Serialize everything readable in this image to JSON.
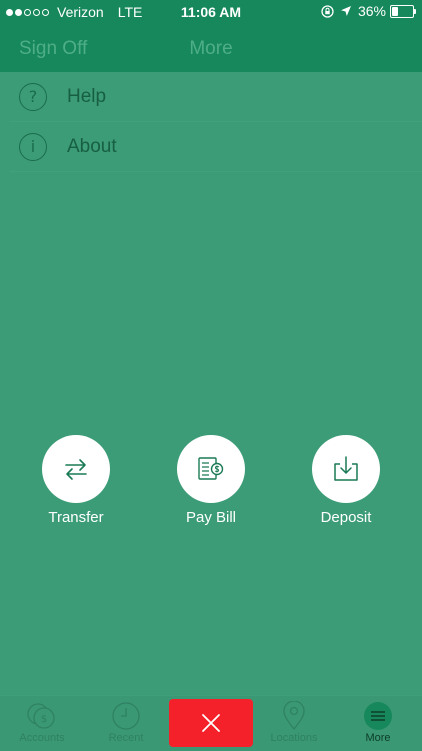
{
  "status_bar": {
    "carrier": "Verizon",
    "network": "LTE",
    "time": "11:06 AM",
    "battery_percent": "36%",
    "battery_level": 0.36,
    "signal_bars": 2,
    "signal_total": 5
  },
  "nav": {
    "left_label": "Sign Off",
    "title": "More"
  },
  "menu": {
    "items": [
      {
        "icon": "help-icon",
        "glyph": "?",
        "label": "Help"
      },
      {
        "icon": "info-icon",
        "glyph": "i",
        "label": "About"
      }
    ]
  },
  "actions": [
    {
      "icon": "transfer-icon",
      "label": "Transfer"
    },
    {
      "icon": "pay-bill-icon",
      "label": "Pay Bill"
    },
    {
      "icon": "deposit-icon",
      "label": "Deposit"
    }
  ],
  "tabs": [
    {
      "icon": "accounts-icon",
      "label": "Accounts"
    },
    {
      "icon": "recent-icon",
      "label": "Recent"
    },
    {
      "icon": "locations-icon",
      "label": "Locations"
    },
    {
      "icon": "more-icon",
      "label": "More",
      "active": true
    }
  ],
  "colors": {
    "header": "#16885c",
    "overlay_green": "#3c9c77",
    "close_red": "#f5212a",
    "text_dark": "#175f42"
  }
}
